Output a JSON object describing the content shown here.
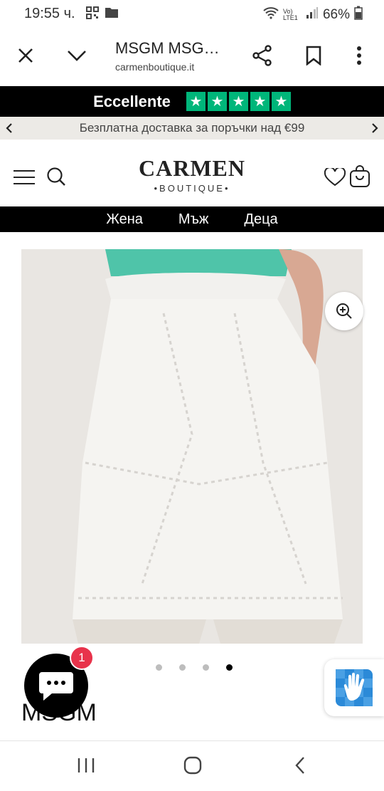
{
  "status_bar": {
    "time": "19:55 ч.",
    "network": "Vo) LTE1",
    "battery": "66%"
  },
  "browser": {
    "tab_title": "MSGM MSG…",
    "url": "carmenboutique.it"
  },
  "trust_bar": {
    "label": "Eccellente",
    "stars": [
      "★",
      "★",
      "★",
      "★",
      "★"
    ],
    "star_color": "#00b67a"
  },
  "promo": {
    "text": "Безплатна доставка за поръчки над €99"
  },
  "logo": {
    "main": "CARMEN",
    "sub": "•BOUTIQUE•"
  },
  "category_nav": [
    "Жена",
    "Мъж",
    "Деца"
  ],
  "gallery": {
    "total": 4,
    "active_index": 3
  },
  "product": {
    "brand": "MSGM"
  },
  "chat": {
    "unread_count": "1",
    "badge_color": "#e8334b"
  }
}
